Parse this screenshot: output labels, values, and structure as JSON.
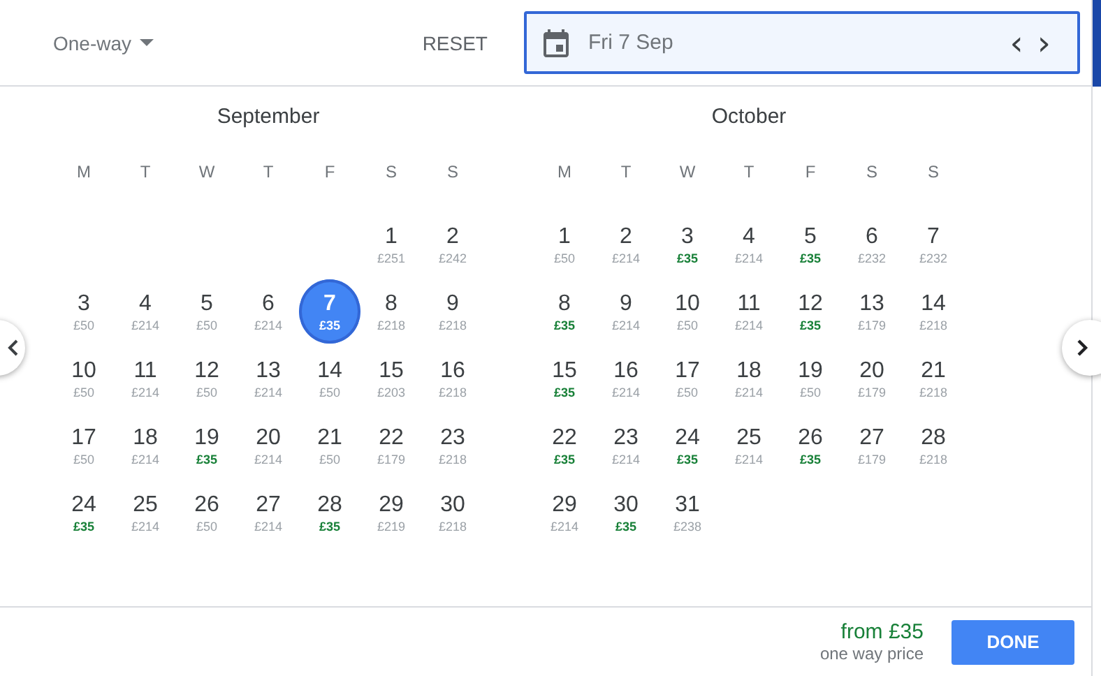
{
  "trip_type": {
    "label": "One-way"
  },
  "reset": "RESET",
  "date_field": {
    "value": "Fri 7 Sep",
    "prev": "‹",
    "next": "›"
  },
  "months": [
    {
      "name": "September",
      "weekdays": [
        "M",
        "T",
        "W",
        "T",
        "F",
        "S",
        "S"
      ],
      "days": [
        {
          "kind": "empty"
        },
        {
          "kind": "empty"
        },
        {
          "kind": "empty"
        },
        {
          "kind": "empty"
        },
        {
          "kind": "empty"
        },
        {
          "kind": "day",
          "date": "1",
          "price": "£251",
          "cheap": false,
          "selected": false
        },
        {
          "kind": "day",
          "date": "2",
          "price": "£242",
          "cheap": false,
          "selected": false
        },
        {
          "kind": "day",
          "date": "3",
          "price": "£50",
          "cheap": false,
          "selected": false
        },
        {
          "kind": "day",
          "date": "4",
          "price": "£214",
          "cheap": false,
          "selected": false
        },
        {
          "kind": "day",
          "date": "5",
          "price": "£50",
          "cheap": false,
          "selected": false
        },
        {
          "kind": "day",
          "date": "6",
          "price": "£214",
          "cheap": false,
          "selected": false
        },
        {
          "kind": "day",
          "date": "7",
          "price": "£35",
          "cheap": true,
          "selected": true
        },
        {
          "kind": "day",
          "date": "8",
          "price": "£218",
          "cheap": false,
          "selected": false
        },
        {
          "kind": "day",
          "date": "9",
          "price": "£218",
          "cheap": false,
          "selected": false
        },
        {
          "kind": "day",
          "date": "10",
          "price": "£50",
          "cheap": false,
          "selected": false
        },
        {
          "kind": "day",
          "date": "11",
          "price": "£214",
          "cheap": false,
          "selected": false
        },
        {
          "kind": "day",
          "date": "12",
          "price": "£50",
          "cheap": false,
          "selected": false
        },
        {
          "kind": "day",
          "date": "13",
          "price": "£214",
          "cheap": false,
          "selected": false
        },
        {
          "kind": "day",
          "date": "14",
          "price": "£50",
          "cheap": false,
          "selected": false
        },
        {
          "kind": "day",
          "date": "15",
          "price": "£203",
          "cheap": false,
          "selected": false
        },
        {
          "kind": "day",
          "date": "16",
          "price": "£218",
          "cheap": false,
          "selected": false
        },
        {
          "kind": "day",
          "date": "17",
          "price": "£50",
          "cheap": false,
          "selected": false
        },
        {
          "kind": "day",
          "date": "18",
          "price": "£214",
          "cheap": false,
          "selected": false
        },
        {
          "kind": "day",
          "date": "19",
          "price": "£35",
          "cheap": true,
          "selected": false
        },
        {
          "kind": "day",
          "date": "20",
          "price": "£214",
          "cheap": false,
          "selected": false
        },
        {
          "kind": "day",
          "date": "21",
          "price": "£50",
          "cheap": false,
          "selected": false
        },
        {
          "kind": "day",
          "date": "22",
          "price": "£179",
          "cheap": false,
          "selected": false
        },
        {
          "kind": "day",
          "date": "23",
          "price": "£218",
          "cheap": false,
          "selected": false
        },
        {
          "kind": "day",
          "date": "24",
          "price": "£35",
          "cheap": true,
          "selected": false
        },
        {
          "kind": "day",
          "date": "25",
          "price": "£214",
          "cheap": false,
          "selected": false
        },
        {
          "kind": "day",
          "date": "26",
          "price": "£50",
          "cheap": false,
          "selected": false
        },
        {
          "kind": "day",
          "date": "27",
          "price": "£214",
          "cheap": false,
          "selected": false
        },
        {
          "kind": "day",
          "date": "28",
          "price": "£35",
          "cheap": true,
          "selected": false
        },
        {
          "kind": "day",
          "date": "29",
          "price": "£219",
          "cheap": false,
          "selected": false
        },
        {
          "kind": "day",
          "date": "30",
          "price": "£218",
          "cheap": false,
          "selected": false
        }
      ]
    },
    {
      "name": "October",
      "weekdays": [
        "M",
        "T",
        "W",
        "T",
        "F",
        "S",
        "S"
      ],
      "days": [
        {
          "kind": "day",
          "date": "1",
          "price": "£50",
          "cheap": false,
          "selected": false
        },
        {
          "kind": "day",
          "date": "2",
          "price": "£214",
          "cheap": false,
          "selected": false
        },
        {
          "kind": "day",
          "date": "3",
          "price": "£35",
          "cheap": true,
          "selected": false
        },
        {
          "kind": "day",
          "date": "4",
          "price": "£214",
          "cheap": false,
          "selected": false
        },
        {
          "kind": "day",
          "date": "5",
          "price": "£35",
          "cheap": true,
          "selected": false
        },
        {
          "kind": "day",
          "date": "6",
          "price": "£232",
          "cheap": false,
          "selected": false
        },
        {
          "kind": "day",
          "date": "7",
          "price": "£232",
          "cheap": false,
          "selected": false
        },
        {
          "kind": "day",
          "date": "8",
          "price": "£35",
          "cheap": true,
          "selected": false
        },
        {
          "kind": "day",
          "date": "9",
          "price": "£214",
          "cheap": false,
          "selected": false
        },
        {
          "kind": "day",
          "date": "10",
          "price": "£50",
          "cheap": false,
          "selected": false
        },
        {
          "kind": "day",
          "date": "11",
          "price": "£214",
          "cheap": false,
          "selected": false
        },
        {
          "kind": "day",
          "date": "12",
          "price": "£35",
          "cheap": true,
          "selected": false
        },
        {
          "kind": "day",
          "date": "13",
          "price": "£179",
          "cheap": false,
          "selected": false
        },
        {
          "kind": "day",
          "date": "14",
          "price": "£218",
          "cheap": false,
          "selected": false
        },
        {
          "kind": "day",
          "date": "15",
          "price": "£35",
          "cheap": true,
          "selected": false
        },
        {
          "kind": "day",
          "date": "16",
          "price": "£214",
          "cheap": false,
          "selected": false
        },
        {
          "kind": "day",
          "date": "17",
          "price": "£50",
          "cheap": false,
          "selected": false
        },
        {
          "kind": "day",
          "date": "18",
          "price": "£214",
          "cheap": false,
          "selected": false
        },
        {
          "kind": "day",
          "date": "19",
          "price": "£50",
          "cheap": false,
          "selected": false
        },
        {
          "kind": "day",
          "date": "20",
          "price": "£179",
          "cheap": false,
          "selected": false
        },
        {
          "kind": "day",
          "date": "21",
          "price": "£218",
          "cheap": false,
          "selected": false
        },
        {
          "kind": "day",
          "date": "22",
          "price": "£35",
          "cheap": true,
          "selected": false
        },
        {
          "kind": "day",
          "date": "23",
          "price": "£214",
          "cheap": false,
          "selected": false
        },
        {
          "kind": "day",
          "date": "24",
          "price": "£35",
          "cheap": true,
          "selected": false
        },
        {
          "kind": "day",
          "date": "25",
          "price": "£214",
          "cheap": false,
          "selected": false
        },
        {
          "kind": "day",
          "date": "26",
          "price": "£35",
          "cheap": true,
          "selected": false
        },
        {
          "kind": "day",
          "date": "27",
          "price": "£179",
          "cheap": false,
          "selected": false
        },
        {
          "kind": "day",
          "date": "28",
          "price": "£218",
          "cheap": false,
          "selected": false
        },
        {
          "kind": "day",
          "date": "29",
          "price": "£214",
          "cheap": false,
          "selected": false
        },
        {
          "kind": "day",
          "date": "30",
          "price": "£35",
          "cheap": true,
          "selected": false
        },
        {
          "kind": "day",
          "date": "31",
          "price": "£238",
          "cheap": false,
          "selected": false
        }
      ]
    }
  ],
  "footer": {
    "from_price": "from £35",
    "price_note": "one way price",
    "done": "DONE"
  }
}
